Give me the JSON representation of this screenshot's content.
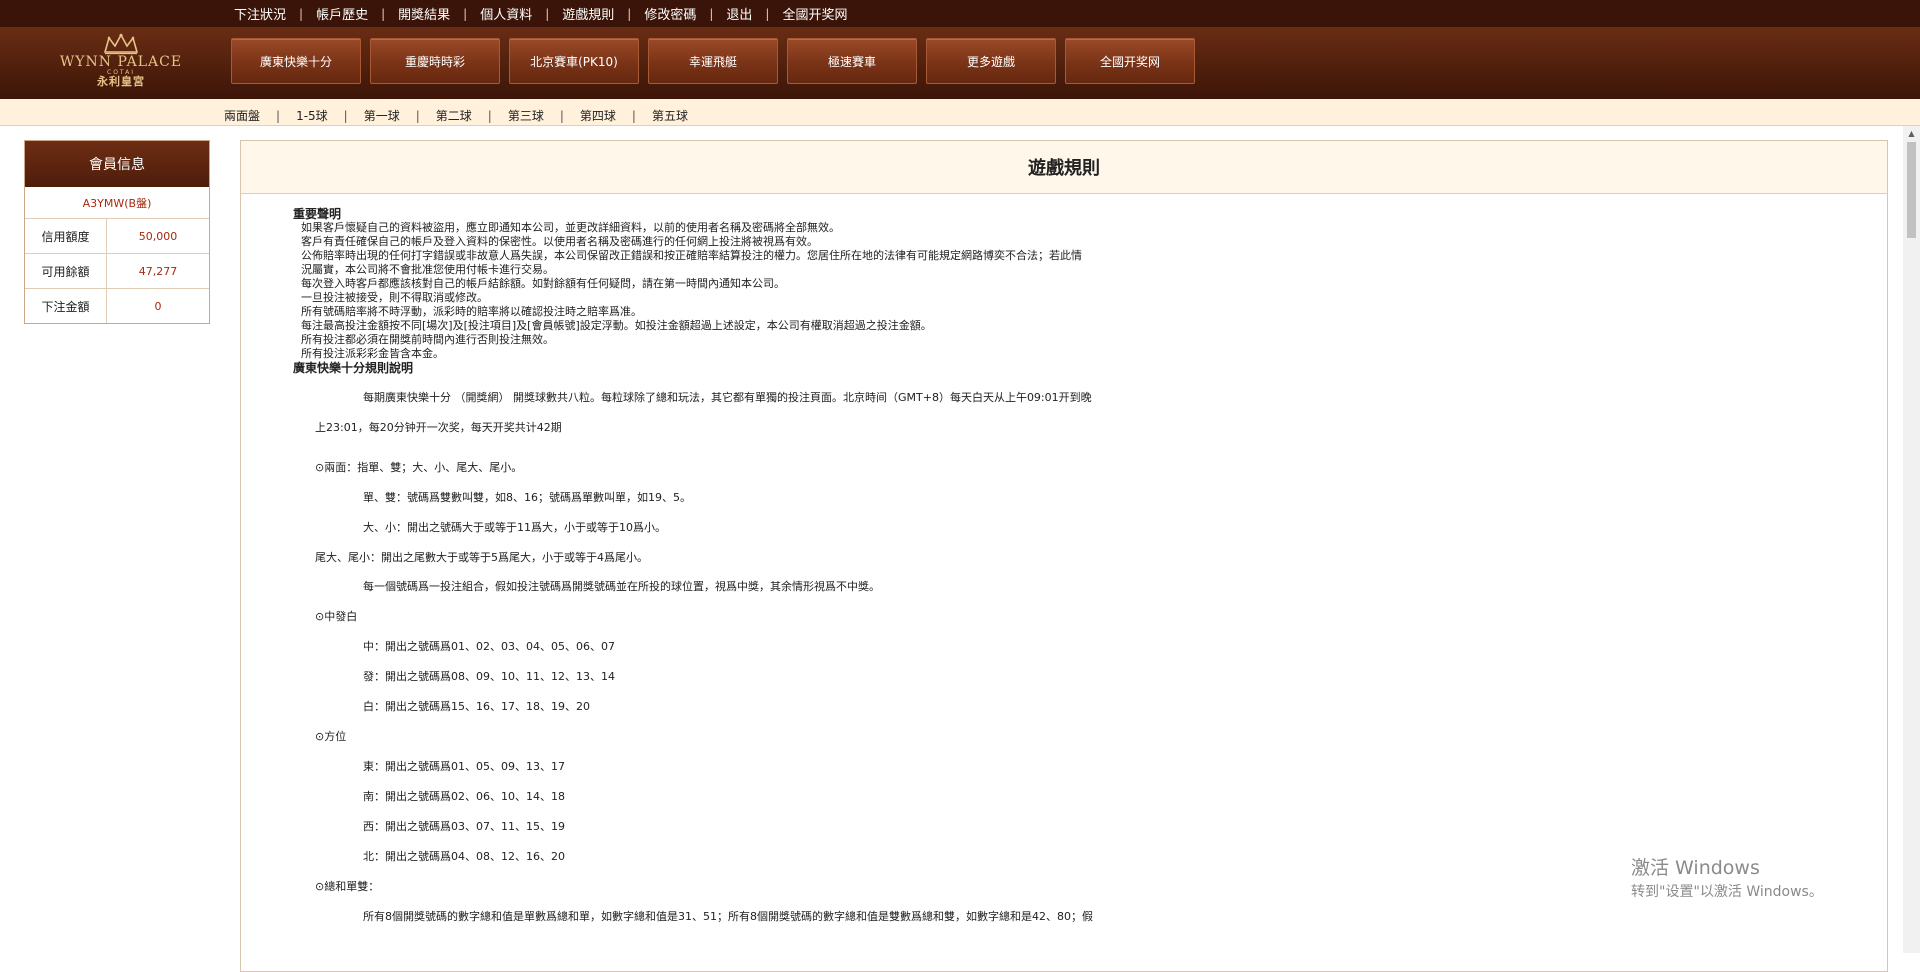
{
  "top_nav": [
    "下注狀況",
    "帳戶歷史",
    "開獎結果",
    "個人資料",
    "遊戲規則",
    "修改密碼",
    "退出",
    "全國开奖网"
  ],
  "logo": {
    "name_en": "WYNN PALACE",
    "sub": "COTAI",
    "name_cn": "永利皇宮"
  },
  "game_tabs": [
    "廣東快樂十分",
    "重慶時時彩",
    "北京賽車(PK10)",
    "幸運飛艇",
    "極速賽車",
    "更多遊戲",
    "全國开奖网"
  ],
  "sub_nav": [
    "兩面盤",
    "1-5球",
    "第一球",
    "第二球",
    "第三球",
    "第四球",
    "第五球"
  ],
  "member": {
    "title": "會員信息",
    "account": "A3YMW(B盤)",
    "rows": [
      {
        "label": "信用額度",
        "value": "50,000"
      },
      {
        "label": "可用餘額",
        "value": "47,277"
      },
      {
        "label": "下注金額",
        "value": "0"
      }
    ]
  },
  "rules": {
    "title": "遊戲規則",
    "notice_title": "重要聲明",
    "notice_lines": [
      "如果客戶懷疑自己的資料被盜用，應立即通知本公司，並更改詳細資料，以前的使用者名稱及密碼將全部無效。",
      "客戶有責任確保自己的帳戶及登入資料的保密性。以使用者名稱及密碼進行的任何網上投注將被視爲有效。",
      "公佈賠率時出現的任何打字錯誤或非故意人爲失誤，本公司保留改正錯誤和按正確賠率結算投注的權力。您居住所在地的法律有可能規定網路博奕不合法；若此情",
      "況屬實，本公司將不會批准您使用付帳卡進行交易。",
      "每次登入時客戶都應該核對自己的帳戶結餘額。如對餘額有任何疑問，請在第一時間內通知本公司。",
      "一旦投注被接受，則不得取消或修改。",
      "所有號碼賠率將不時浮動，派彩時的賠率將以確認投注時之賠率爲准。",
      "每注最高投注金額按不同[場次]及[投注項目]及[會員帳號]設定浮動。如投注金額超過上述設定，本公司有權取消超過之投注金額。",
      "所有投注都必須在開獎前時間內進行否則投注無效。",
      "所有投注派彩彩金皆含本金。"
    ],
    "game_title": "廣東快樂十分規則說明",
    "intro_1": "每期廣東快樂十分 （開獎網） 開獎球數共八粒。每粒球除了總和玩法，其它都有單獨的投注頁面。北京時间（GMT+8）每天白天从上午09:01开到晚",
    "intro_2": "上23:01，每20分钟开一次奖，每天开奖共计42期",
    "two_sides_title": "⊙兩面：指單、雙；大、小、尾大、尾小。",
    "odd_even": "單、雙：號碼爲雙數叫雙，如8、16；號碼爲單數叫單，如19、5。",
    "big_small": "大、小：開出之號碼大于或等于11爲大，小于或等于10爲小。",
    "tail": "尾大、尾小：開出之尾數大于或等于5爲尾大，小于或等于4爲尾小。",
    "combo_note": "每一個號碼爲一投注組合，假如投注號碼爲開獎號碼並在所投的球位置，視爲中獎，其余情形視爲不中獎。",
    "zfb_title": "⊙中發白",
    "zfb": [
      "中：開出之號碼爲01、02、03、04、05、06、07",
      "發：開出之號碼爲08、09、10、11、12、13、14",
      "白：開出之號碼爲15、16、17、18、19、20"
    ],
    "dir_title": "⊙方位",
    "dir": [
      "東：開出之號碼爲01、05、09、13、17",
      "南：開出之號碼爲02、06、10、14、18",
      "西：開出之號碼爲03、07、11、15、19",
      "北：開出之號碼爲04、08、12、16、20"
    ],
    "sum_title": "⊙總和單雙：",
    "sum_line": "所有8個開獎號碼的數字總和值是單數爲總和單，如數字總和值是31、51；所有8個開獎號碼的數字總和值是雙數爲總和雙，如數字總和是42、80；假"
  },
  "watermark": {
    "line1": "激活 Windows",
    "line2": "转到\"设置\"以激活 Windows。"
  }
}
